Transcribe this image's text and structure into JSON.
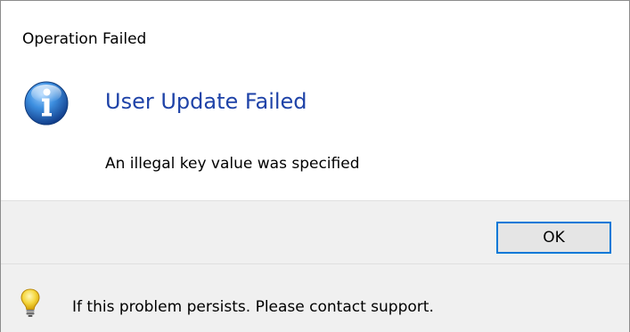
{
  "window": {
    "title": "Operation Failed"
  },
  "content": {
    "icon": "info-icon",
    "main_instruction": "User Update Failed",
    "message": "An illegal key value was specified"
  },
  "buttons": {
    "ok_label": "OK"
  },
  "footer": {
    "icon": "lightbulb-icon",
    "text": "If this problem persists. Please contact support."
  },
  "colors": {
    "main_instruction": "#1f43a8",
    "button_focus_border": "#0078d7",
    "panel_background": "#f0f0f0"
  }
}
